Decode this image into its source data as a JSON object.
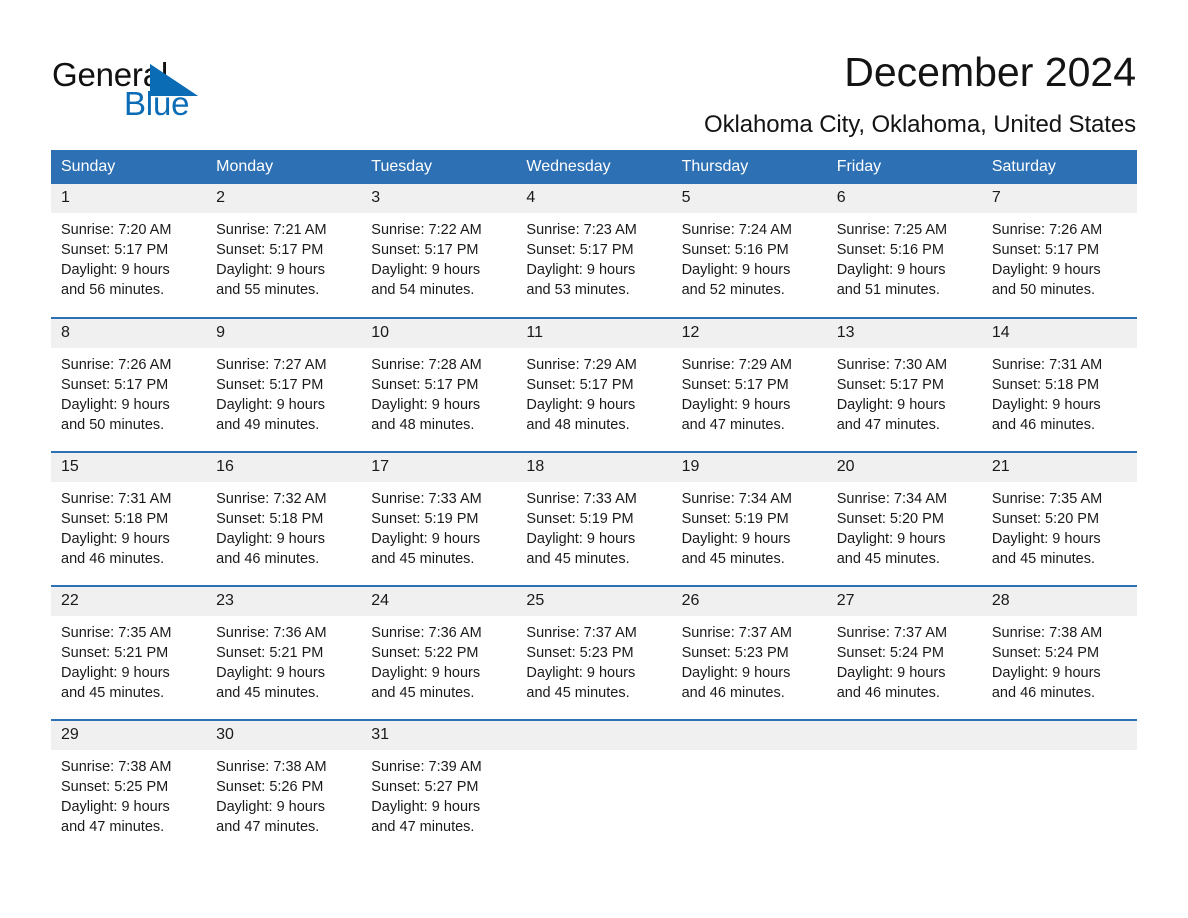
{
  "brand": {
    "name_part1": "General",
    "name_part2": "Blue",
    "triangle_color": "#0b6cb6"
  },
  "header": {
    "title": "December 2024",
    "subtitle": "Oklahoma City, Oklahoma, United States"
  },
  "theme": {
    "header_blue": "#2e70b4",
    "daynum_gray": "#f0f0f0",
    "text_color": "#1a1a1a"
  },
  "calendar": {
    "weekday_headers": [
      "Sunday",
      "Monday",
      "Tuesday",
      "Wednesday",
      "Thursday",
      "Friday",
      "Saturday"
    ],
    "weeks": [
      [
        {
          "day": "1",
          "sunrise": "Sunrise: 7:20 AM",
          "sunset": "Sunset: 5:17 PM",
          "daylight1": "Daylight: 9 hours",
          "daylight2": "and 56 minutes."
        },
        {
          "day": "2",
          "sunrise": "Sunrise: 7:21 AM",
          "sunset": "Sunset: 5:17 PM",
          "daylight1": "Daylight: 9 hours",
          "daylight2": "and 55 minutes."
        },
        {
          "day": "3",
          "sunrise": "Sunrise: 7:22 AM",
          "sunset": "Sunset: 5:17 PM",
          "daylight1": "Daylight: 9 hours",
          "daylight2": "and 54 minutes."
        },
        {
          "day": "4",
          "sunrise": "Sunrise: 7:23 AM",
          "sunset": "Sunset: 5:17 PM",
          "daylight1": "Daylight: 9 hours",
          "daylight2": "and 53 minutes."
        },
        {
          "day": "5",
          "sunrise": "Sunrise: 7:24 AM",
          "sunset": "Sunset: 5:16 PM",
          "daylight1": "Daylight: 9 hours",
          "daylight2": "and 52 minutes."
        },
        {
          "day": "6",
          "sunrise": "Sunrise: 7:25 AM",
          "sunset": "Sunset: 5:16 PM",
          "daylight1": "Daylight: 9 hours",
          "daylight2": "and 51 minutes."
        },
        {
          "day": "7",
          "sunrise": "Sunrise: 7:26 AM",
          "sunset": "Sunset: 5:17 PM",
          "daylight1": "Daylight: 9 hours",
          "daylight2": "and 50 minutes."
        }
      ],
      [
        {
          "day": "8",
          "sunrise": "Sunrise: 7:26 AM",
          "sunset": "Sunset: 5:17 PM",
          "daylight1": "Daylight: 9 hours",
          "daylight2": "and 50 minutes."
        },
        {
          "day": "9",
          "sunrise": "Sunrise: 7:27 AM",
          "sunset": "Sunset: 5:17 PM",
          "daylight1": "Daylight: 9 hours",
          "daylight2": "and 49 minutes."
        },
        {
          "day": "10",
          "sunrise": "Sunrise: 7:28 AM",
          "sunset": "Sunset: 5:17 PM",
          "daylight1": "Daylight: 9 hours",
          "daylight2": "and 48 minutes."
        },
        {
          "day": "11",
          "sunrise": "Sunrise: 7:29 AM",
          "sunset": "Sunset: 5:17 PM",
          "daylight1": "Daylight: 9 hours",
          "daylight2": "and 48 minutes."
        },
        {
          "day": "12",
          "sunrise": "Sunrise: 7:29 AM",
          "sunset": "Sunset: 5:17 PM",
          "daylight1": "Daylight: 9 hours",
          "daylight2": "and 47 minutes."
        },
        {
          "day": "13",
          "sunrise": "Sunrise: 7:30 AM",
          "sunset": "Sunset: 5:17 PM",
          "daylight1": "Daylight: 9 hours",
          "daylight2": "and 47 minutes."
        },
        {
          "day": "14",
          "sunrise": "Sunrise: 7:31 AM",
          "sunset": "Sunset: 5:18 PM",
          "daylight1": "Daylight: 9 hours",
          "daylight2": "and 46 minutes."
        }
      ],
      [
        {
          "day": "15",
          "sunrise": "Sunrise: 7:31 AM",
          "sunset": "Sunset: 5:18 PM",
          "daylight1": "Daylight: 9 hours",
          "daylight2": "and 46 minutes."
        },
        {
          "day": "16",
          "sunrise": "Sunrise: 7:32 AM",
          "sunset": "Sunset: 5:18 PM",
          "daylight1": "Daylight: 9 hours",
          "daylight2": "and 46 minutes."
        },
        {
          "day": "17",
          "sunrise": "Sunrise: 7:33 AM",
          "sunset": "Sunset: 5:19 PM",
          "daylight1": "Daylight: 9 hours",
          "daylight2": "and 45 minutes."
        },
        {
          "day": "18",
          "sunrise": "Sunrise: 7:33 AM",
          "sunset": "Sunset: 5:19 PM",
          "daylight1": "Daylight: 9 hours",
          "daylight2": "and 45 minutes."
        },
        {
          "day": "19",
          "sunrise": "Sunrise: 7:34 AM",
          "sunset": "Sunset: 5:19 PM",
          "daylight1": "Daylight: 9 hours",
          "daylight2": "and 45 minutes."
        },
        {
          "day": "20",
          "sunrise": "Sunrise: 7:34 AM",
          "sunset": "Sunset: 5:20 PM",
          "daylight1": "Daylight: 9 hours",
          "daylight2": "and 45 minutes."
        },
        {
          "day": "21",
          "sunrise": "Sunrise: 7:35 AM",
          "sunset": "Sunset: 5:20 PM",
          "daylight1": "Daylight: 9 hours",
          "daylight2": "and 45 minutes."
        }
      ],
      [
        {
          "day": "22",
          "sunrise": "Sunrise: 7:35 AM",
          "sunset": "Sunset: 5:21 PM",
          "daylight1": "Daylight: 9 hours",
          "daylight2": "and 45 minutes."
        },
        {
          "day": "23",
          "sunrise": "Sunrise: 7:36 AM",
          "sunset": "Sunset: 5:21 PM",
          "daylight1": "Daylight: 9 hours",
          "daylight2": "and 45 minutes."
        },
        {
          "day": "24",
          "sunrise": "Sunrise: 7:36 AM",
          "sunset": "Sunset: 5:22 PM",
          "daylight1": "Daylight: 9 hours",
          "daylight2": "and 45 minutes."
        },
        {
          "day": "25",
          "sunrise": "Sunrise: 7:37 AM",
          "sunset": "Sunset: 5:23 PM",
          "daylight1": "Daylight: 9 hours",
          "daylight2": "and 45 minutes."
        },
        {
          "day": "26",
          "sunrise": "Sunrise: 7:37 AM",
          "sunset": "Sunset: 5:23 PM",
          "daylight1": "Daylight: 9 hours",
          "daylight2": "and 46 minutes."
        },
        {
          "day": "27",
          "sunrise": "Sunrise: 7:37 AM",
          "sunset": "Sunset: 5:24 PM",
          "daylight1": "Daylight: 9 hours",
          "daylight2": "and 46 minutes."
        },
        {
          "day": "28",
          "sunrise": "Sunrise: 7:38 AM",
          "sunset": "Sunset: 5:24 PM",
          "daylight1": "Daylight: 9 hours",
          "daylight2": "and 46 minutes."
        }
      ],
      [
        {
          "day": "29",
          "sunrise": "Sunrise: 7:38 AM",
          "sunset": "Sunset: 5:25 PM",
          "daylight1": "Daylight: 9 hours",
          "daylight2": "and 47 minutes."
        },
        {
          "day": "30",
          "sunrise": "Sunrise: 7:38 AM",
          "sunset": "Sunset: 5:26 PM",
          "daylight1": "Daylight: 9 hours",
          "daylight2": "and 47 minutes."
        },
        {
          "day": "31",
          "sunrise": "Sunrise: 7:39 AM",
          "sunset": "Sunset: 5:27 PM",
          "daylight1": "Daylight: 9 hours",
          "daylight2": "and 47 minutes."
        },
        {
          "day": "",
          "sunrise": "",
          "sunset": "",
          "daylight1": "",
          "daylight2": ""
        },
        {
          "day": "",
          "sunrise": "",
          "sunset": "",
          "daylight1": "",
          "daylight2": ""
        },
        {
          "day": "",
          "sunrise": "",
          "sunset": "",
          "daylight1": "",
          "daylight2": ""
        },
        {
          "day": "",
          "sunrise": "",
          "sunset": "",
          "daylight1": "",
          "daylight2": ""
        }
      ]
    ]
  }
}
